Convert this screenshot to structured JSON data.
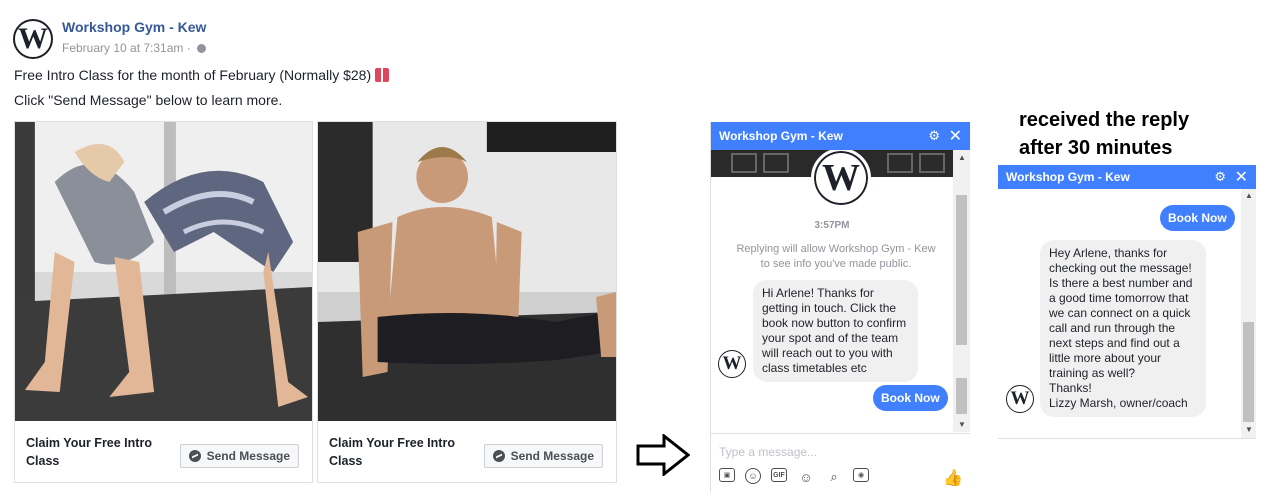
{
  "post": {
    "page_name": "Workshop Gym - Kew",
    "timestamp": "February 10 at 7:31am · ",
    "avatar_letter": "W",
    "line1": "Free Intro Class for the month of February (Normally $28)",
    "line2": "Click \"Send Message\" below to learn more."
  },
  "cards": [
    {
      "title": "Claim Your Free Intro Class",
      "button": "Send Message",
      "image": "woman-backbend-photo"
    },
    {
      "title": "Claim Your Free Intro Class",
      "button": "Send Message",
      "image": "man-l-sit-photo"
    }
  ],
  "chat1": {
    "title": "Workshop Gym - Kew",
    "time": "3:57PM",
    "note": "Replying will allow Workshop Gym - Kew to see info you've made public.",
    "message": "Hi Arlene! Thanks for getting in touch. Click the book now button to confirm your spot and of the team will reach out to you with class timetables etc",
    "button": "Book Now",
    "placeholder": "Type a message...",
    "icons": [
      "photo-icon",
      "sticker-icon",
      "gif-icon",
      "emoji-icon",
      "attach-icon",
      "camera-icon",
      "like-icon"
    ]
  },
  "caption": {
    "line1": "received the reply",
    "line2": "after 30 minutes"
  },
  "chat2": {
    "title": "Workshop Gym - Kew",
    "button": "Book Now",
    "message": "Hey Arlene, thanks for checking out the message! Is there a best number and a good time tomorrow that we can connect on a quick call and run through the next steps and find out a little more about your training as well?\nThanks!\nLizzy Marsh, owner/coach"
  },
  "colors": {
    "messenger_blue": "#4080ff",
    "link_blue": "#365899",
    "bubble_gray": "#f1f0f0"
  }
}
